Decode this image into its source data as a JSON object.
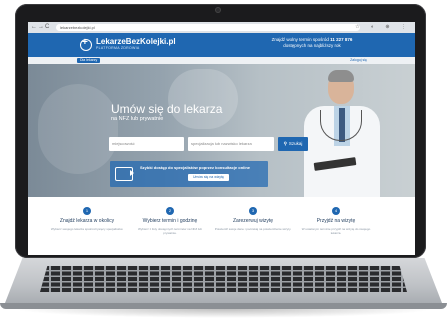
{
  "browser": {
    "url": "lekarzebezkolejki.pl",
    "nav": [
      "←",
      "→",
      "C"
    ],
    "icons": "☆ ◐ ⊕ ⋮"
  },
  "header": {
    "logo_title": "LekarzeBezKolejki.pl",
    "logo_subtitle": "PLATFORMA ZDROWIA",
    "promo_line1": "Znajdź wolny termin spośród",
    "promo_count": "11 227 876",
    "promo_line2": "dostępnych na najbliższy rok"
  },
  "subbar": {
    "pill_label": "Dla lekarzy",
    "login_label": "Zaloguj się"
  },
  "hero": {
    "title": "Umów się do lekarza",
    "subtitle": "na NFZ lub prywatnie",
    "city_placeholder": "miejscowość",
    "specialty_placeholder": "specjalizacja lub nazwisko lekarza",
    "search_label": "Szukaj"
  },
  "promo": {
    "text": "Szybki dostęp do specjalistów poprzez konsultacje online",
    "button": "Umów się na wizytę"
  },
  "steps": [
    {
      "num": "1",
      "title": "Znajdź lekarza w okolicy",
      "desc": "Wybierz swojego lekarza spośród tysięcy specjalistów."
    },
    {
      "num": "2",
      "title": "Wybierz termin i godzinę",
      "desc": "Wybierz z listy dostępnych terminów na NFZ lub prywatnie."
    },
    {
      "num": "3",
      "title": "Zarezerwuj wizytę",
      "desc": "Potwierdź swoje dane i poczekaj na potwierdzenie wizyty."
    },
    {
      "num": "4",
      "title": "Przyjdź na wizytę",
      "desc": "W ustalonym terminie przyjdź na wizytę do swojego lekarza."
    }
  ],
  "colors": {
    "brand": "#1f67b1",
    "laptop_bezel": "#1b1b1d"
  }
}
